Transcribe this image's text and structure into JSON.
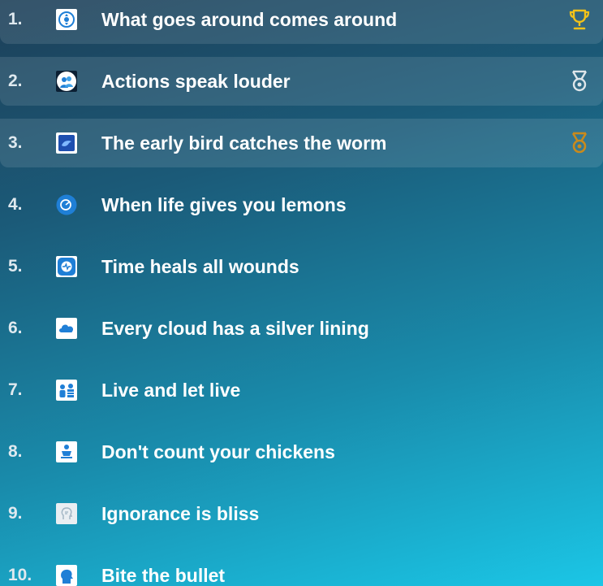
{
  "leaderboard": {
    "items": [
      {
        "rank": "1.",
        "title": "What goes around comes around",
        "icon": "circular-arrows-icon",
        "award": "trophy-gold-icon"
      },
      {
        "rank": "2.",
        "title": "Actions speak louder",
        "icon": "people-circle-icon",
        "award": "medal-silver-icon"
      },
      {
        "rank": "3.",
        "title": "The early bird catches the worm",
        "icon": "bird-icon",
        "award": "medal-bronze-icon"
      },
      {
        "rank": "4.",
        "title": "When life gives you lemons",
        "icon": "lemon-icon"
      },
      {
        "rank": "5.",
        "title": "Time heals all wounds",
        "icon": "clock-icon"
      },
      {
        "rank": "6.",
        "title": "Every cloud has a silver lining",
        "icon": "cloud-icon"
      },
      {
        "rank": "7.",
        "title": "Live and let live",
        "icon": "people-icon"
      },
      {
        "rank": "8.",
        "title": "Don't count your chickens",
        "icon": "chicken-icon"
      },
      {
        "rank": "9.",
        "title": "Ignorance is bliss",
        "icon": "head-outline-icon"
      },
      {
        "rank": "10.",
        "title": "Bite the bullet",
        "icon": "head-silhouette-icon"
      }
    ]
  },
  "colors": {
    "gold": "#f2c21a",
    "silver": "#dfe6ea",
    "bronze": "#c98a1c",
    "icon_blue": "#1f7fd6"
  }
}
